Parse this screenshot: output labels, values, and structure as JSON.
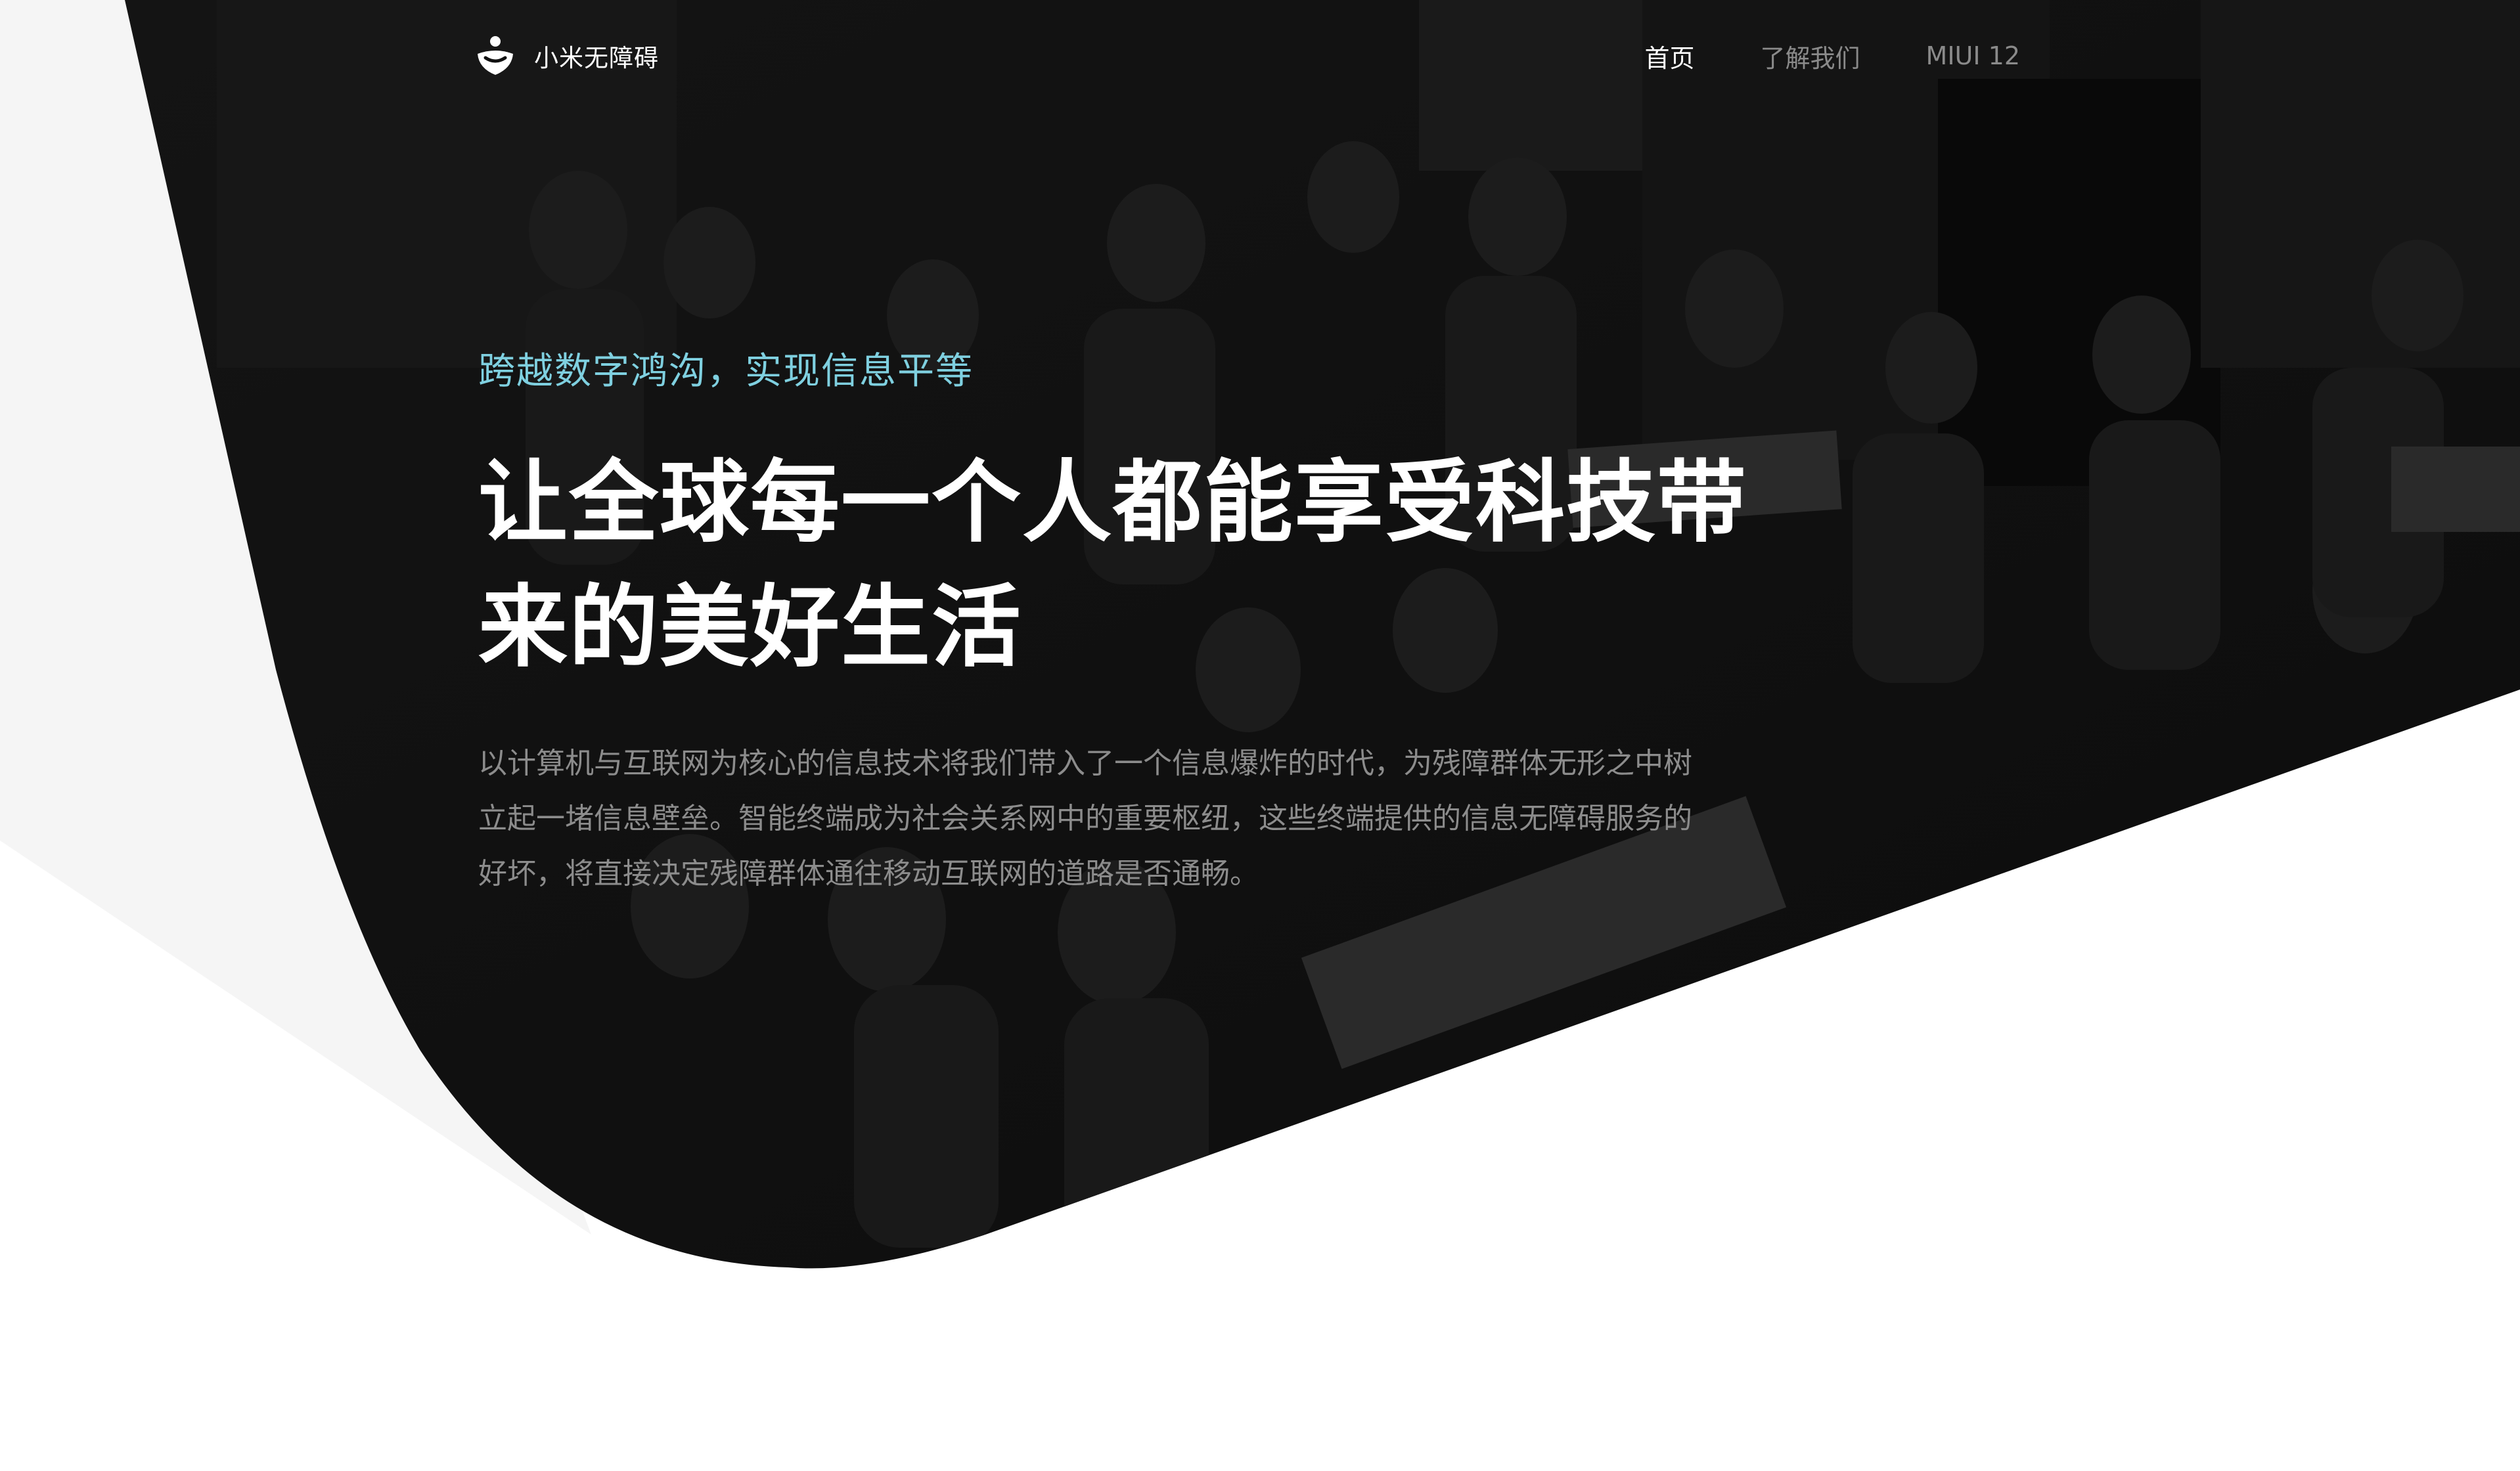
{
  "brand": {
    "logo_icon": "accessibility-figure-logo",
    "name": "小米无障碍"
  },
  "nav": {
    "items": [
      {
        "label": "首页",
        "active": true
      },
      {
        "label": "了解我们",
        "active": false
      },
      {
        "label": "MIUI 12",
        "active": false
      }
    ]
  },
  "hero": {
    "tagline": "跨越数字鸿沟，实现信息平等",
    "headline_line1": "让全球每一个人都能享受科技带",
    "headline_line2": "来的美好生活",
    "description": "以计算机与互联网为核心的信息技术将我们带入了一个信息爆炸的时代，为残障群体无形之中树立起一堵信息壁垒。智能终端成为社会关系网中的重要枢纽，这些终端提供的信息无障碍服务的好坏，将直接决定残障群体通往移动互联网的道路是否通畅。"
  },
  "colors": {
    "hero_background": "#111111",
    "tagline": "#7fd0e0",
    "nav_active": "#ffffff",
    "nav_inactive": "#8a8a8a",
    "description": "#8c8c8c",
    "side_wedge": "#f5f5f5"
  }
}
